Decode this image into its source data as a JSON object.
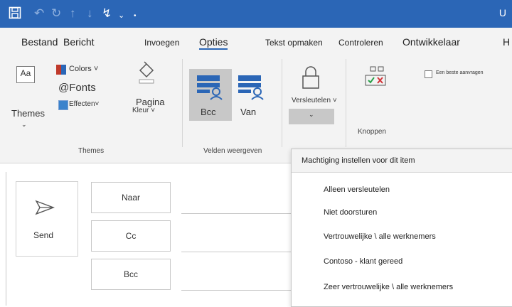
{
  "titlebar": {
    "icons": [
      "save-icon",
      "undo-icon",
      "redo-icon",
      "up-arrow-icon",
      "down-arrow-icon",
      "paperclip-icon",
      "customize-dropdown-icon"
    ],
    "right_char": "U"
  },
  "tabs": [
    "Bestand",
    "Bericht",
    "Invoegen",
    "Opties",
    "Tekst opmaken",
    "Controleren",
    "Ontwikkelaar",
    "H"
  ],
  "ribbon": {
    "themes_group": {
      "themes": "Themes",
      "themes_icon": "Aa",
      "colors": "Colors ˅",
      "fonts": "@Fonts",
      "effects": "Effecten˅",
      "pagina": "Pagina",
      "kleur": "Kleur ˅",
      "label": "Themes"
    },
    "fields_group": {
      "bcc": "Bcc",
      "van": "Van",
      "label": "Velden weergeven"
    },
    "encrypt": {
      "label": "Versleutelen ˅"
    },
    "buttons_group": {
      "checkbox_label": "Een beste aanvragen",
      "label": "Knoppen"
    }
  },
  "compose": {
    "send": "Send",
    "to": "Naar",
    "cc": "Cc",
    "bcc": "Bcc"
  },
  "menu": {
    "header": "Machtiging instellen voor dit item",
    "items": [
      "Alleen versleutelen",
      "Niet doorsturen",
      "Vertrouwelijke \\ alle werknemers",
      "Contoso - klant gereed",
      "Zeer vertrouwelijke \\ alle werknemers"
    ]
  },
  "colors": {
    "accent": "#2b66b6",
    "ribbon": "#f3f3f3",
    "highlight": "#c8c8c8"
  }
}
